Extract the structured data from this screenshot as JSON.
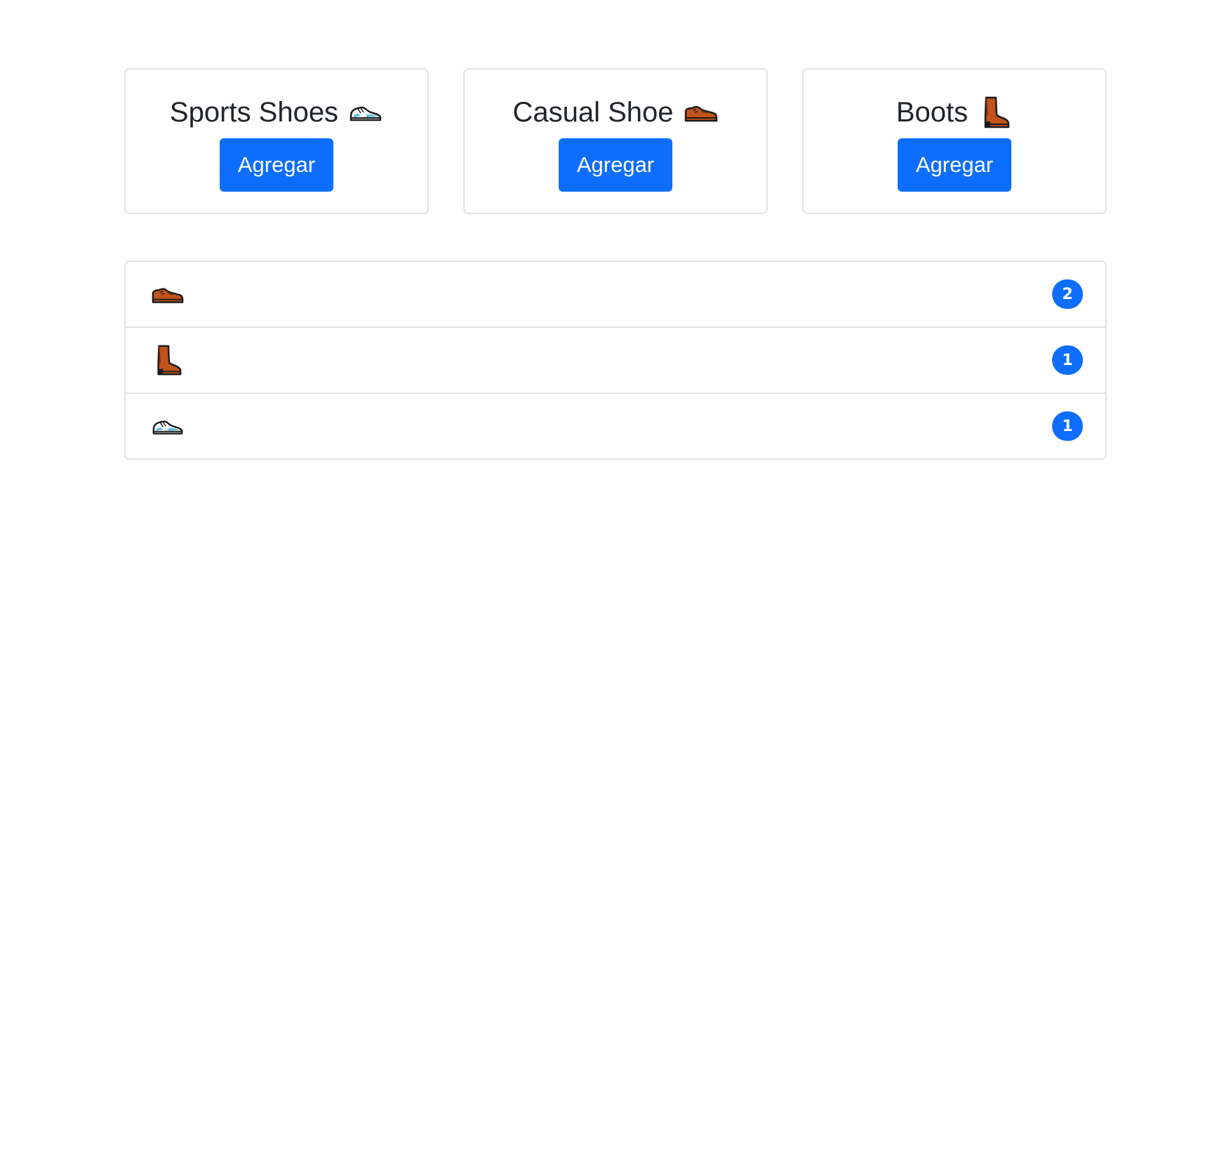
{
  "products": [
    {
      "name": "Sports Shoes",
      "icon": "running-shoe-icon",
      "button_label": "Agregar"
    },
    {
      "name": "Casual Shoe",
      "icon": "mans-shoe-icon",
      "button_label": "Agregar"
    },
    {
      "name": "Boots",
      "icon": "boot-icon",
      "button_label": "Agregar"
    }
  ],
  "cart": [
    {
      "icon": "mans-shoe-icon",
      "count": "2"
    },
    {
      "icon": "boot-icon",
      "count": "1"
    },
    {
      "icon": "running-shoe-icon",
      "count": "1"
    }
  ],
  "colors": {
    "primary": "#0d6efd",
    "border": "#dee2e6",
    "text": "#212529",
    "shoe_brown": "#c1531b",
    "sneaker_blue": "#5bc0de"
  }
}
